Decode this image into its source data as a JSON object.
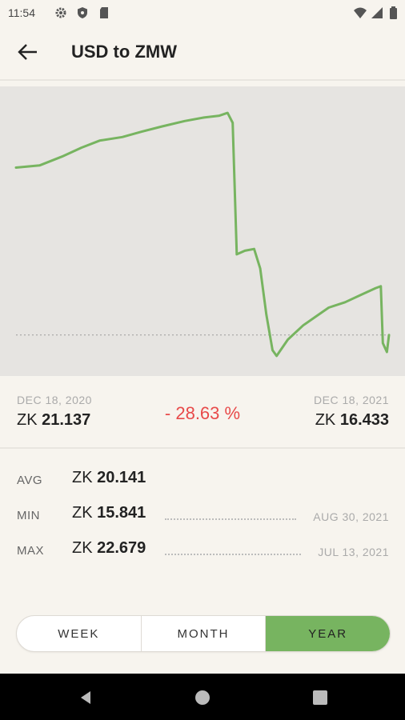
{
  "status_bar": {
    "time": "11:54",
    "icons": [
      "gear-icon",
      "shield-icon",
      "sd-card-icon",
      "wifi-icon",
      "signal-icon",
      "battery-icon"
    ]
  },
  "app_bar": {
    "title": "USD to ZMW",
    "back_icon": "arrow-left-icon"
  },
  "colors": {
    "background": "#f7f4ee",
    "chart_background": "#e6e4e1",
    "line": "#77b460",
    "negative_change": "#e84a4a",
    "active_toggle": "#77b460"
  },
  "range": {
    "start_date": "DEC 18, 2020",
    "start_currency": "ZK",
    "start_rate": "21.137",
    "change": "- 28.63 %",
    "end_date": "DEC 18, 2021",
    "end_currency": "ZK",
    "end_rate": "16.433"
  },
  "stats": {
    "avg": {
      "label": "AVG",
      "currency": "ZK",
      "value": "20.141"
    },
    "min": {
      "label": "MIN",
      "currency": "ZK",
      "value": "15.841",
      "date": "AUG 30, 2021"
    },
    "max": {
      "label": "MAX",
      "currency": "ZK",
      "value": "22.679",
      "date": "JUL 13, 2021"
    }
  },
  "period_toggle": {
    "options": [
      "WEEK",
      "MONTH",
      "YEAR"
    ],
    "selected": "YEAR"
  },
  "chart_data": {
    "type": "line",
    "x": [
      "2020-12-18",
      "2021-01-10",
      "2021-02-01",
      "2021-02-20",
      "2021-03-10",
      "2021-04-01",
      "2021-04-20",
      "2021-05-10",
      "2021-06-01",
      "2021-06-20",
      "2021-07-05",
      "2021-07-13",
      "2021-07-18",
      "2021-07-22",
      "2021-07-30",
      "2021-08-08",
      "2021-08-14",
      "2021-08-20",
      "2021-08-26",
      "2021-08-30",
      "2021-09-10",
      "2021-09-25",
      "2021-10-10",
      "2021-10-20",
      "2021-11-05",
      "2021-11-20",
      "2021-12-05",
      "2021-12-10",
      "2021-12-12",
      "2021-12-16",
      "2021-12-18"
    ],
    "series": [
      {
        "values": [
          21.14,
          21.2,
          21.45,
          21.7,
          21.9,
          22.0,
          22.15,
          22.3,
          22.45,
          22.55,
          22.6,
          22.68,
          22.4,
          18.7,
          18.8,
          18.85,
          18.3,
          17.0,
          16.0,
          15.84,
          16.3,
          16.7,
          17.0,
          17.2,
          17.35,
          17.55,
          17.75,
          17.8,
          16.2,
          15.95,
          16.43
        ]
      }
    ],
    "baseline": 16.43,
    "ylim": [
      15.5,
      23.2
    ],
    "grid": false,
    "legend": "none"
  }
}
